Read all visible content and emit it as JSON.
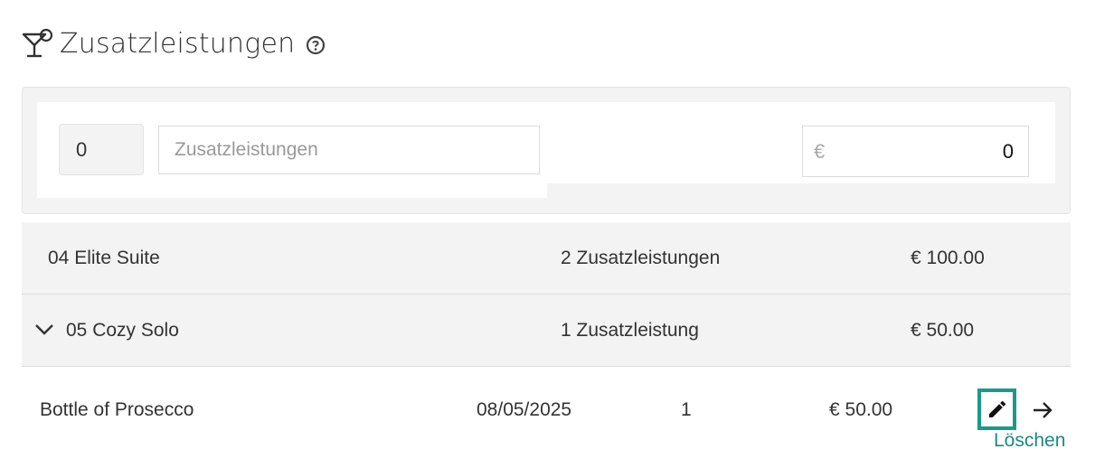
{
  "header": {
    "title": "Zusatzleistungen",
    "icon": "cocktail-icon",
    "help_icon": "help-circle-icon"
  },
  "filter": {
    "quantity_value": "0",
    "name_placeholder": "Zusatzleistungen",
    "currency_symbol": "€",
    "price_value": "0"
  },
  "groups": [
    {
      "name": "04 Elite Suite",
      "count_label": "2 Zusatzleistungen",
      "price": "€ 100.00",
      "expanded": false
    },
    {
      "name": "05 Cozy Solo",
      "count_label": "1 Zusatzleistung",
      "price": "€ 50.00",
      "expanded": true
    }
  ],
  "items": [
    {
      "name": "Bottle of Prosecco",
      "date": "08/05/2025",
      "quantity": "1",
      "price": "€ 50.00"
    }
  ],
  "actions": {
    "delete_label": "Löschen",
    "edit_icon": "pencil-icon",
    "move_icon": "arrow-right-icon"
  },
  "colors": {
    "accent": "#1a9a8a",
    "row_background": "#f3f3f3",
    "text": "#333333"
  }
}
